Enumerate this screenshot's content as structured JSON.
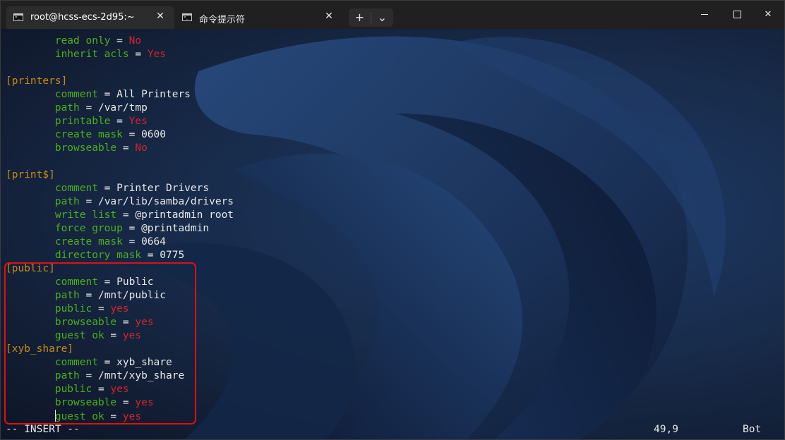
{
  "tabs": [
    {
      "title": "root@hcss-ecs-2d95:~",
      "icon": "terminal-icon",
      "close": "✕"
    },
    {
      "title": "命令提示符",
      "icon": "terminal-icon",
      "close": "✕"
    }
  ],
  "toolbar": {
    "new_tab": "+",
    "dropdown": "⌄"
  },
  "window_controls": {
    "close": "✕"
  },
  "code_lines": [
    {
      "indent": "        ",
      "key": "read only",
      "sep": " = ",
      "value": "No",
      "vtype": "bool"
    },
    {
      "indent": "        ",
      "key": "inherit acls",
      "sep": " = ",
      "value": "Yes",
      "vtype": "bool"
    },
    {
      "indent": "",
      "key": "",
      "sep": "",
      "value": "",
      "vtype": "plain"
    },
    {
      "section": "[printers]"
    },
    {
      "indent": "        ",
      "key": "comment",
      "sep": " = ",
      "value": "All Printers",
      "vtype": "plain"
    },
    {
      "indent": "        ",
      "key": "path",
      "sep": " = ",
      "value": "/var/tmp",
      "vtype": "plain"
    },
    {
      "indent": "        ",
      "key": "printable",
      "sep": " = ",
      "value": "Yes",
      "vtype": "bool"
    },
    {
      "indent": "        ",
      "key": "create mask",
      "sep": " = ",
      "value": "0600",
      "vtype": "plain"
    },
    {
      "indent": "        ",
      "key": "browseable",
      "sep": " = ",
      "value": "No",
      "vtype": "bool"
    },
    {
      "indent": "",
      "key": "",
      "sep": "",
      "value": "",
      "vtype": "plain"
    },
    {
      "section": "[print$]"
    },
    {
      "indent": "        ",
      "key": "comment",
      "sep": " = ",
      "value": "Printer Drivers",
      "vtype": "plain"
    },
    {
      "indent": "        ",
      "key": "path",
      "sep": " = ",
      "value": "/var/lib/samba/drivers",
      "vtype": "plain"
    },
    {
      "indent": "        ",
      "key": "write list",
      "sep": " = ",
      "value": "@printadmin root",
      "vtype": "plain"
    },
    {
      "indent": "        ",
      "key": "force group",
      "sep": " = ",
      "value": "@printadmin",
      "vtype": "plain"
    },
    {
      "indent": "        ",
      "key": "create mask",
      "sep": " = ",
      "value": "0664",
      "vtype": "plain"
    },
    {
      "indent": "        ",
      "key": "directory mask",
      "sep": " = ",
      "value": "0775",
      "vtype": "plain"
    },
    {
      "section": "[public]"
    },
    {
      "indent": "        ",
      "key": "comment",
      "sep": " = ",
      "value": "Public",
      "vtype": "plain"
    },
    {
      "indent": "        ",
      "key": "path",
      "sep": " = ",
      "value": "/mnt/public",
      "vtype": "plain"
    },
    {
      "indent": "        ",
      "key": "public",
      "sep": " = ",
      "value": "yes",
      "vtype": "bool"
    },
    {
      "indent": "        ",
      "key": "browseable",
      "sep": " = ",
      "value": "yes",
      "vtype": "bool"
    },
    {
      "indent": "        ",
      "key": "guest ok",
      "sep": " = ",
      "value": "yes",
      "vtype": "bool"
    },
    {
      "section": "[xyb_share]"
    },
    {
      "indent": "        ",
      "key": "comment",
      "sep": " = ",
      "value": "xyb_share",
      "vtype": "plain"
    },
    {
      "indent": "        ",
      "key": "path",
      "sep": " = ",
      "value": "/mnt/xyb_share",
      "vtype": "plain"
    },
    {
      "indent": "        ",
      "key": "public",
      "sep": " = ",
      "value": "yes",
      "vtype": "bool"
    },
    {
      "indent": "        ",
      "key": "browseable",
      "sep": " = ",
      "value": "yes",
      "vtype": "bool"
    },
    {
      "indent": "        ",
      "key": "guest ok",
      "sep": " = ",
      "value": "yes",
      "vtype": "bool",
      "cursor": true
    }
  ],
  "status": {
    "mode": "-- INSERT --",
    "position": "49,9",
    "scroll": "Bot"
  },
  "colors": {
    "key": "#4caf1a",
    "section": "#c88a12",
    "bool": "#d0262b",
    "text": "#e8e8e8",
    "highlight": "#e01010"
  }
}
